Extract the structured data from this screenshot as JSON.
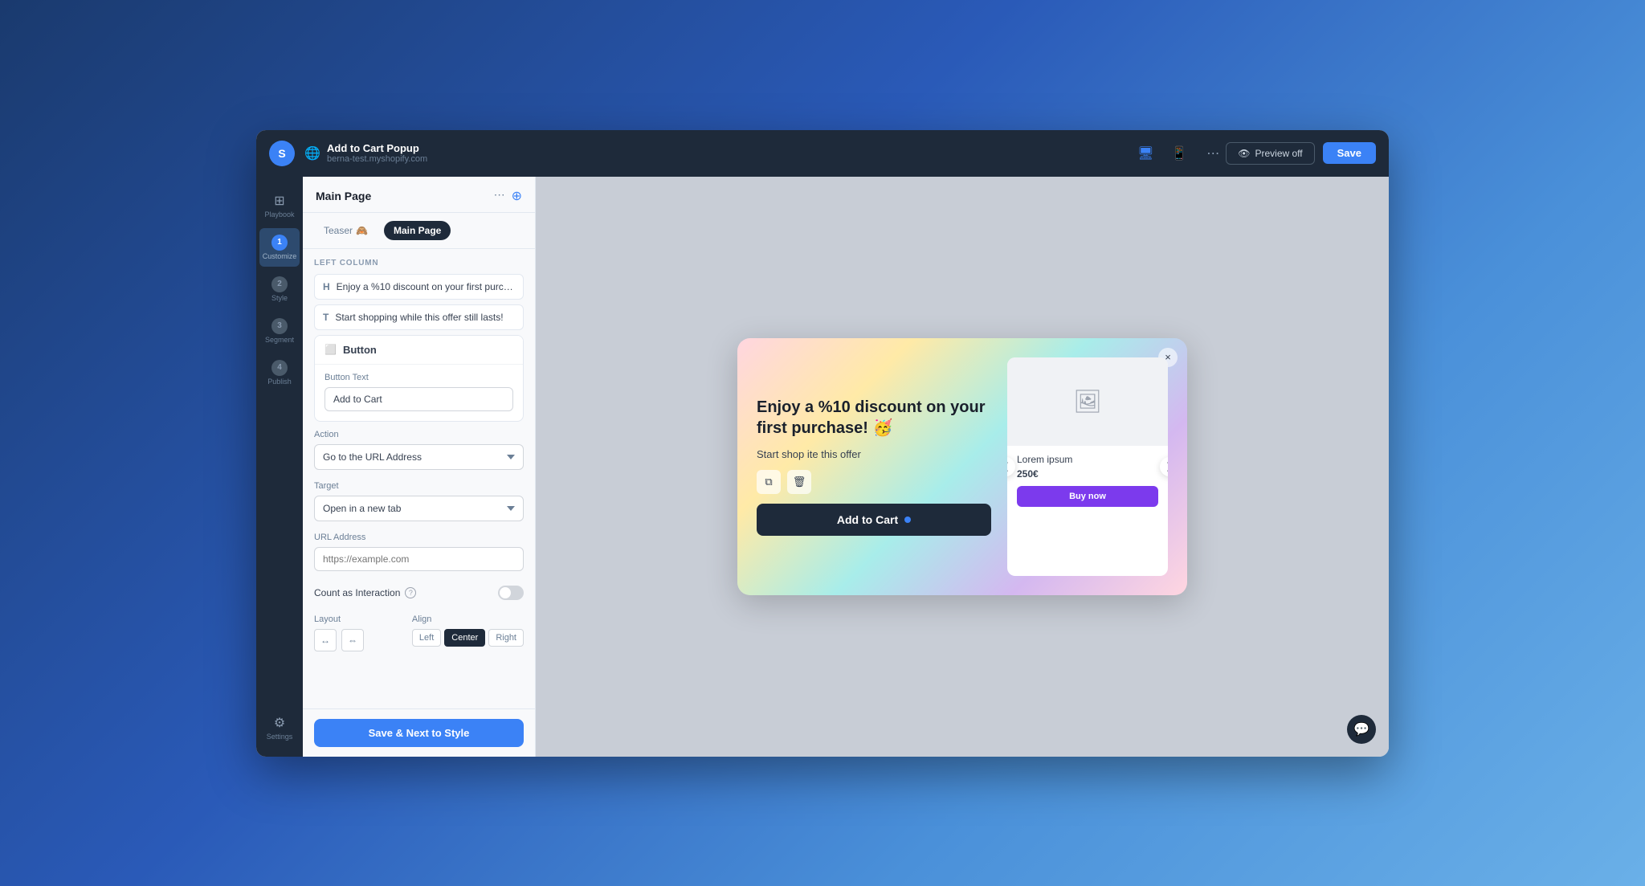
{
  "header": {
    "logo_letter": "S",
    "title": "Add to Cart Popup",
    "subtitle": "berna-test.myshopify.com",
    "preview_label": "Preview off",
    "save_label": "Save"
  },
  "nav": {
    "items": [
      {
        "number": "1",
        "label": "Customize",
        "active": true
      },
      {
        "number": "2",
        "label": "Style",
        "active": false
      },
      {
        "number": "3",
        "label": "Segment",
        "active": false
      },
      {
        "number": "4",
        "label": "Publish",
        "active": false
      }
    ],
    "bottom_item": {
      "label": "Settings"
    }
  },
  "sidebar": {
    "title": "Main Page",
    "tabs": [
      {
        "label": "Teaser",
        "active": false
      },
      {
        "label": "Main Page",
        "active": true
      }
    ],
    "section_label": "LEFT COLUMN",
    "content_items": [
      {
        "type": "H",
        "text": "Enjoy a %10 discount on your first purch..."
      },
      {
        "type": "T",
        "text": "Start shopping while this offer still lasts!"
      }
    ],
    "button_card": {
      "title": "Button",
      "button_text_label": "Button Text",
      "button_text_value": "Add to Cart"
    },
    "action": {
      "label": "Action",
      "value": "Go to the URL Address"
    },
    "target": {
      "label": "Target",
      "value": "Open in a new tab"
    },
    "url_address": {
      "label": "URL Address",
      "placeholder": "https://example.com"
    },
    "count_interaction": {
      "label": "Count as Interaction",
      "enabled": false
    },
    "layout": {
      "label": "Layout"
    },
    "align": {
      "label": "Align",
      "options": [
        "Left",
        "Center",
        "Right"
      ],
      "active": "Center"
    },
    "save_next_label": "Save & Next to Style"
  },
  "popup": {
    "heading": "Enjoy a %10 discount on your first purchase! 🥳",
    "subtext": "Start shop      ite this offer",
    "cta_button": "Add to Cart",
    "product_name": "Lorem ipsum",
    "product_price": "250€",
    "product_buy_btn": "Buy now"
  },
  "icons": {
    "close": "×",
    "prev_arrow": "❮",
    "next_arrow": "❯",
    "image_placeholder": "🖼",
    "duplicate": "⧉",
    "trash": "🗑",
    "chat": "💬",
    "eye_off": "👁",
    "more_dots": "⋯",
    "plus_circle": "⊕",
    "button_icon": "⬜",
    "globe": "🌐",
    "desktop": "🖥",
    "mobile": "📱",
    "settings_gear": "⚙"
  }
}
